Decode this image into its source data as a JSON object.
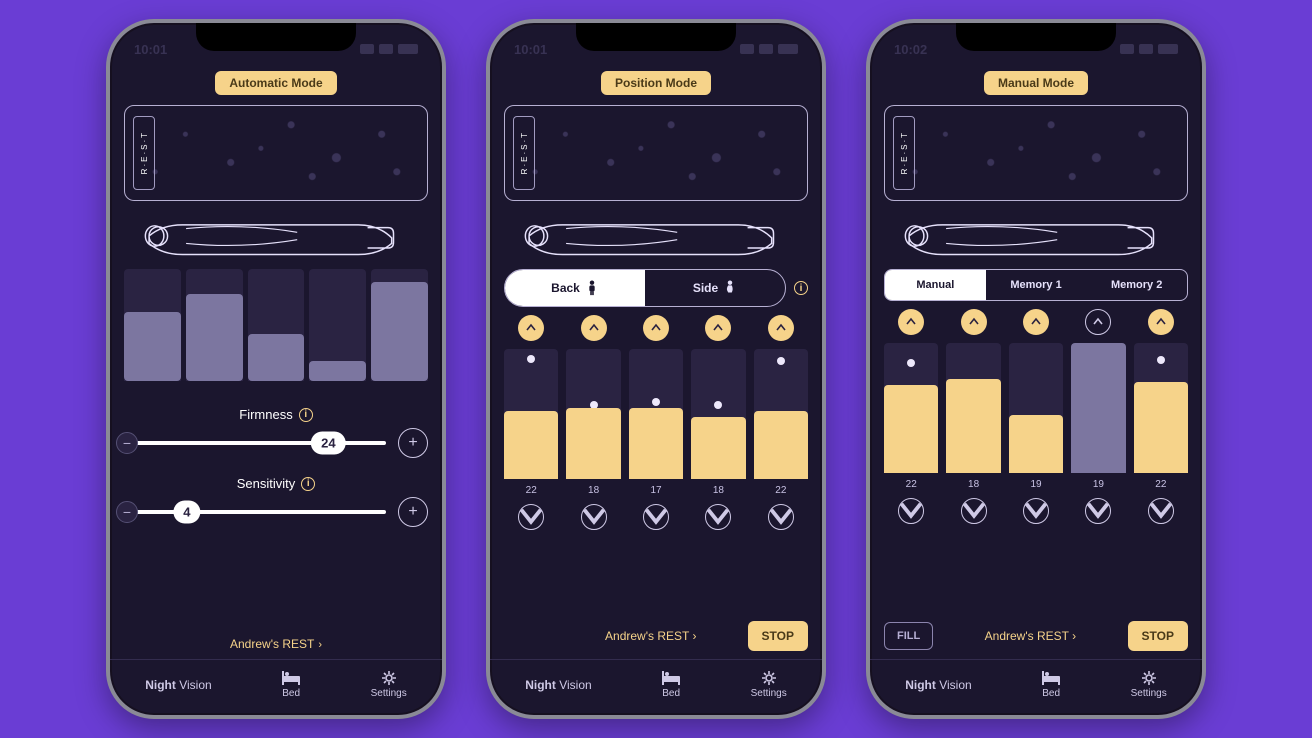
{
  "background_color": "#6a3dd4",
  "phones": {
    "auto": {
      "status_time": "10:01",
      "mode_chip": "Automatic Mode",
      "rest_label": "R·E·S·T",
      "firmness": {
        "label": "Firmness",
        "value": "24"
      },
      "sensitivity": {
        "label": "Sensitivity",
        "value": "4"
      },
      "profile_link": "Andrew's REST",
      "tabs": {
        "logo1": "Night",
        "logo2": "Vision",
        "bed": "Bed",
        "settings": "Settings"
      },
      "zone_heights_pct": [
        62,
        78,
        42,
        18,
        88
      ]
    },
    "position": {
      "status_time": "10:01",
      "mode_chip": "Position Mode",
      "rest_label": "R·E·S·T",
      "segments": {
        "back": "Back",
        "side": "Side"
      },
      "zone_values": [
        "22",
        "18",
        "17",
        "18",
        "22"
      ],
      "zone_heights_pct": [
        52,
        55,
        55,
        48,
        52
      ],
      "stop": "STOP",
      "profile_link": "Andrew's REST",
      "tabs": {
        "logo1": "Night",
        "logo2": "Vision",
        "bed": "Bed",
        "settings": "Settings"
      }
    },
    "manual": {
      "status_time": "10:02",
      "mode_chip": "Manual Mode",
      "rest_label": "R·E·S·T",
      "segments": {
        "manual": "Manual",
        "m1": "Memory 1",
        "m2": "Memory 2"
      },
      "zone_values": [
        "22",
        "18",
        "19",
        "19",
        "22"
      ],
      "zone_heights_pct": [
        68,
        72,
        45,
        0,
        70
      ],
      "fill": "FILL",
      "stop": "STOP",
      "profile_link": "Andrew's REST",
      "tabs": {
        "logo1": "Night",
        "logo2": "Vision",
        "bed": "Bed",
        "settings": "Settings"
      }
    }
  }
}
